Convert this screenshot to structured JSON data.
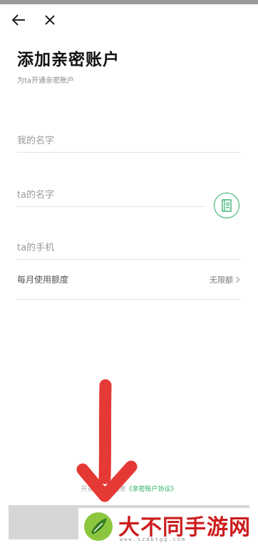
{
  "header": {
    "back_icon": "arrow-left-icon",
    "close_icon": "close-icon"
  },
  "page": {
    "title": "添加亲密账户",
    "subtitle": "为ta开通亲密账户"
  },
  "form": {
    "my_name_placeholder": "我的名字",
    "ta_name_placeholder": "ta的名字",
    "ta_phone_placeholder": "ta的手机",
    "contact_icon": "contact-book-icon",
    "limit_label": "每月使用额度",
    "limit_value": "无限额",
    "chevron_icon": "chevron-right-icon"
  },
  "footer": {
    "agreement_prefix": "开通即表示同意",
    "agreement_link": "《亲密账户协议》",
    "submit_label": ""
  },
  "watermark": {
    "text": "大不同手游网",
    "url": "www.szdbtgg.com"
  },
  "colors": {
    "accent": "#2aae67",
    "annotation_arrow": "#e53935",
    "watermark": "#cc1d1d"
  }
}
